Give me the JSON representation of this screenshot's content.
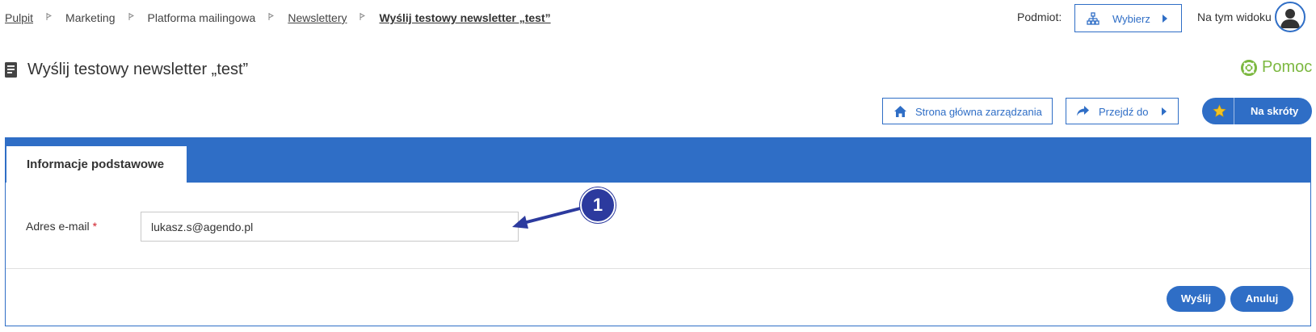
{
  "breadcrumb": {
    "items": [
      {
        "label": "Pulpit",
        "link": true
      },
      {
        "label": "Marketing",
        "link": false
      },
      {
        "label": "Platforma mailingowa",
        "link": false
      },
      {
        "label": "Newslettery",
        "link": true
      },
      {
        "label": "Wyślij testowy newsletter „test”",
        "link": true
      }
    ]
  },
  "topbar": {
    "subject_label": "Podmiot:",
    "select_button": "Wybierz",
    "view_label": "Na tym widoku"
  },
  "page": {
    "title": "Wyślij testowy newsletter „test”",
    "help_label": "Pomoc"
  },
  "actions": {
    "home": "Strona główna zarządzania",
    "goto": "Przejdź do",
    "shortcuts": "Na skróty"
  },
  "form": {
    "tab_label": "Informacje podstawowe",
    "email_label": "Adres e-mail",
    "required_mark": "*",
    "email_value": "lukasz.s@agendo.pl",
    "send_button": "Wyślij",
    "cancel_button": "Anuluj"
  },
  "annotation": {
    "number": "1"
  },
  "colors": {
    "primary": "#2f6ec6",
    "help_green": "#7cb840",
    "required_red": "#d0212c",
    "annotation": "#2c3a9e"
  },
  "icons": {
    "breadcrumb_separator": "flag-icon",
    "select": "org-chart-icon",
    "avatar": "user-icon",
    "title": "document-icon",
    "help": "lifebuoy-icon",
    "home": "home-icon",
    "goto": "share-arrow-icon",
    "shortcuts": "star-icon"
  }
}
